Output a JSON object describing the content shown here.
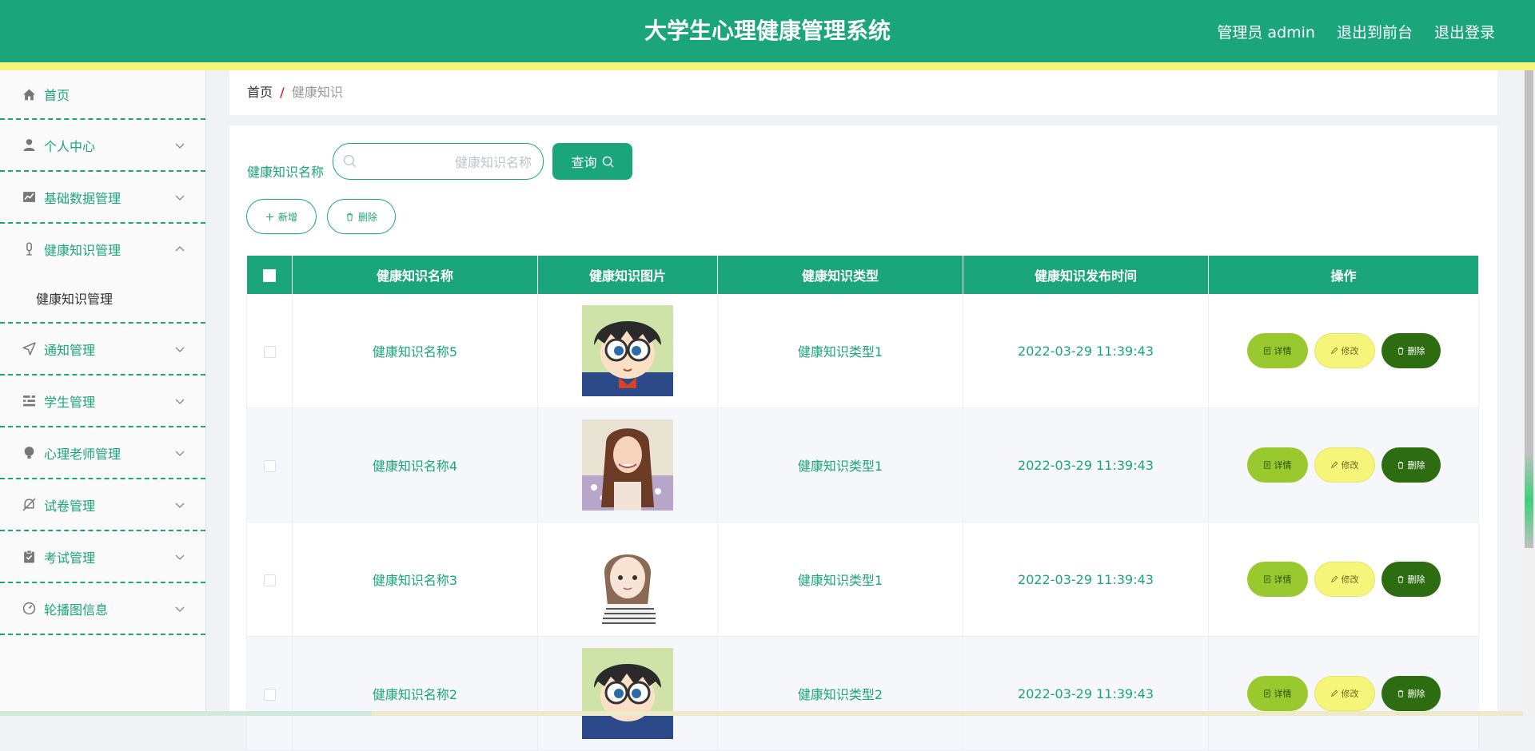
{
  "header": {
    "title": "大学生心理健康管理系统",
    "user_label": "管理员 admin",
    "frontend_label": "退出到前台",
    "logout_label": "退出登录",
    "bg_color": "#1aa67a",
    "stripe_color": "#f5f57a"
  },
  "sidebar": {
    "items": [
      {
        "label": "首页",
        "icon": "home-icon"
      },
      {
        "label": "个人中心",
        "icon": "user-icon"
      },
      {
        "label": "基础数据管理",
        "icon": "chart-icon"
      },
      {
        "label": "健康知识管理",
        "icon": "microphone-icon",
        "expanded": true
      },
      {
        "label": "通知管理",
        "icon": "send-icon"
      },
      {
        "label": "学生管理",
        "icon": "sliders-icon"
      },
      {
        "label": "心理老师管理",
        "icon": "bulb-icon"
      },
      {
        "label": "试卷管理",
        "icon": "bell-off-icon"
      },
      {
        "label": "考试管理",
        "icon": "clipboard-icon"
      },
      {
        "label": "轮播图信息",
        "icon": "gauge-icon"
      }
    ],
    "submenu": {
      "label": "健康知识管理"
    }
  },
  "breadcrumb": {
    "home": "首页",
    "separator": "/",
    "current": "健康知识"
  },
  "search": {
    "label": "健康知识名称",
    "placeholder": "健康知识名称",
    "value": "",
    "query_label": "查询"
  },
  "actions": {
    "add_label": "新增",
    "delete_label": "删除"
  },
  "table": {
    "columns": [
      "健康知识名称",
      "健康知识图片",
      "健康知识类型",
      "健康知识发布时间",
      "操作"
    ],
    "rows": [
      {
        "name": "健康知识名称5",
        "image": "anime-boy-glasses",
        "type": "健康知识类型1",
        "time": "2022-03-29 11:39:43"
      },
      {
        "name": "健康知识名称4",
        "image": "girl-photo",
        "type": "健康知识类型1",
        "time": "2022-03-29 11:39:43"
      },
      {
        "name": "健康知识名称3",
        "image": "cartoon-girl-sketch",
        "type": "健康知识类型1",
        "time": "2022-03-29 11:39:43"
      },
      {
        "name": "健康知识名称2",
        "image": "anime-boy-glasses",
        "type": "健康知识类型2",
        "time": "2022-03-29 11:39:43"
      }
    ],
    "op_detail": "详情",
    "op_edit": "修改",
    "op_delete": "删除"
  }
}
